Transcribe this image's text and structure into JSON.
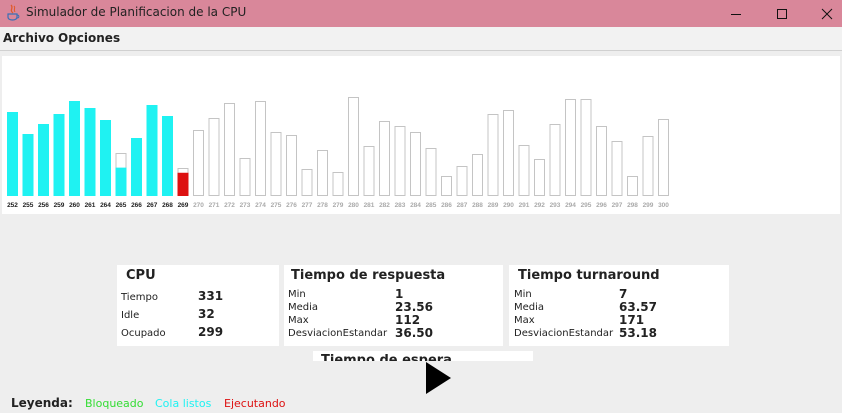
{
  "window": {
    "title": "Simulador de Planificacion de la CPU"
  },
  "menu": {
    "file": "Archivo",
    "options": "Opciones"
  },
  "colors": {
    "queued": "#1ff2f2",
    "running": "#dd1111",
    "outline": "#c4c4c4",
    "blocked_legend": "#33dd33"
  },
  "bars": [
    {
      "label": "252",
      "state": "queued",
      "level": 0.84
    },
    {
      "label": "255",
      "state": "queued",
      "level": 0.62
    },
    {
      "label": "256",
      "state": "queued",
      "level": 0.72
    },
    {
      "label": "259",
      "state": "queued",
      "level": 0.82
    },
    {
      "label": "260",
      "state": "queued",
      "level": 0.95
    },
    {
      "label": "261",
      "state": "queued",
      "level": 0.88
    },
    {
      "label": "264",
      "state": "queued",
      "level": 0.76
    },
    {
      "label": "265",
      "state": "queued",
      "level": 0.43,
      "top": 0.34
    },
    {
      "label": "266",
      "state": "queued",
      "level": 0.58
    },
    {
      "label": "267",
      "state": "queued",
      "level": 0.91
    },
    {
      "label": "268",
      "state": "queued",
      "level": 0.8
    },
    {
      "label": "269",
      "state": "running",
      "level": 0.28,
      "top": 0.17
    },
    {
      "label": "270",
      "state": "pending",
      "level": 0.66
    },
    {
      "label": "271",
      "state": "pending",
      "level": 0.78
    },
    {
      "label": "272",
      "state": "pending",
      "level": 0.93
    },
    {
      "label": "273",
      "state": "pending",
      "level": 0.38
    },
    {
      "label": "274",
      "state": "pending",
      "level": 0.95
    },
    {
      "label": "275",
      "state": "pending",
      "level": 0.64
    },
    {
      "label": "276",
      "state": "pending",
      "level": 0.61
    },
    {
      "label": "277",
      "state": "pending",
      "level": 0.27
    },
    {
      "label": "278",
      "state": "pending",
      "level": 0.46
    },
    {
      "label": "279",
      "state": "pending",
      "level": 0.24
    },
    {
      "label": "280",
      "state": "pending",
      "level": 0.99
    },
    {
      "label": "281",
      "state": "pending",
      "level": 0.5
    },
    {
      "label": "282",
      "state": "pending",
      "level": 0.75
    },
    {
      "label": "283",
      "state": "pending",
      "level": 0.7
    },
    {
      "label": "284",
      "state": "pending",
      "level": 0.64
    },
    {
      "label": "285",
      "state": "pending",
      "level": 0.48
    },
    {
      "label": "286",
      "state": "pending",
      "level": 0.2
    },
    {
      "label": "287",
      "state": "pending",
      "level": 0.3
    },
    {
      "label": "288",
      "state": "pending",
      "level": 0.42
    },
    {
      "label": "289",
      "state": "pending",
      "level": 0.82
    },
    {
      "label": "290",
      "state": "pending",
      "level": 0.86
    },
    {
      "label": "291",
      "state": "pending",
      "level": 0.51
    },
    {
      "label": "292",
      "state": "pending",
      "level": 0.37
    },
    {
      "label": "293",
      "state": "pending",
      "level": 0.72
    },
    {
      "label": "294",
      "state": "pending",
      "level": 0.97
    },
    {
      "label": "295",
      "state": "pending",
      "level": 0.97
    },
    {
      "label": "296",
      "state": "pending",
      "level": 0.7
    },
    {
      "label": "297",
      "state": "pending",
      "level": 0.55
    },
    {
      "label": "298",
      "state": "pending",
      "level": 0.2
    },
    {
      "label": "299",
      "state": "pending",
      "level": 0.6
    },
    {
      "label": "300",
      "state": "pending",
      "level": 0.77
    }
  ],
  "cpu": {
    "title": "CPU",
    "rows": [
      {
        "label": "Tiempo",
        "value": "331"
      },
      {
        "label": "Idle",
        "value": "32"
      },
      {
        "label": "Ocupado",
        "value": "299"
      }
    ]
  },
  "response": {
    "title": "Tiempo de respuesta",
    "rows": [
      {
        "label": "Min",
        "value": "1"
      },
      {
        "label": "Media",
        "value": "23.56"
      },
      {
        "label": "Max",
        "value": "112"
      },
      {
        "label": "DesviacionEstandar",
        "value": "36.50"
      }
    ]
  },
  "turnaround": {
    "title": "Tiempo turnaround",
    "rows": [
      {
        "label": "Min",
        "value": "7"
      },
      {
        "label": "Media",
        "value": "63.57"
      },
      {
        "label": "Max",
        "value": "171"
      },
      {
        "label": "DesviacionEstandar",
        "value": "53.18"
      }
    ]
  },
  "wait": {
    "title": "Tiempo de espera"
  },
  "legend": {
    "title": "Leyenda:",
    "blocked": "Bloqueado",
    "queue": "Cola listos",
    "running": "Ejecutando"
  }
}
